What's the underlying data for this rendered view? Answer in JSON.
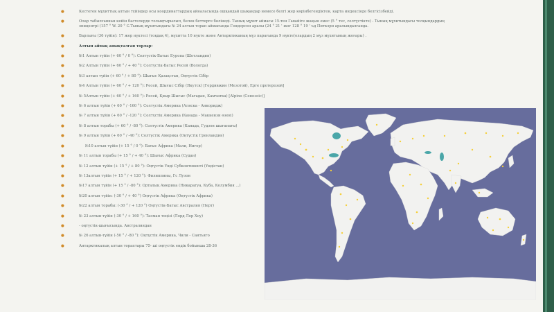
{
  "bullets": [
    {
      "text": "Кестеген мұхиттық алтын түйіндер осы координаттардың айналасында ошқандай шықандар немесе белгі жер көрінбегендіктен, карта индексінде белгісізбейді."
    },
    {
      "text": "Олар табылғаннан кейін бастелерде толықтырылып, белек беттерге бөлінеді. Тынық мұхит аймағы 15-тен Гавайіге жақын емес (5 ° тес, солтүстікте) - Тынық мұхитындағы толқындардың эпицентрі (157 ° W. 20 ° С.Тынық мұхитындағы № 24 алтын торап аймағында Гендерсон аралы (24 ° 21 ' жоғ 128 ° 19 ' ъд Питкэрн аралындалғанда."
    },
    {
      "text": "Барлығы (36 түйін): 17 жер нүктесі (тоқдақ 4), мұхитта 10 нүкте және Антарктиканың мұз парағында 9 нүкте(олардың 2 мұз мұхитының жоғары) ."
    },
    {
      "text": "Алтын аймақ анықталған торлар:",
      "head": true
    },
    {
      "text": "№1 Алтын түйін (+ 60 ° / 0 °): Солтүстік-Батыс Еуропа (Шотландия)"
    },
    {
      "text": "№2 Алтын түйін (+ 60 ° / + 40 °): Солтүстік-Батыс Ресей (Вологда)"
    },
    {
      "text": "№3 алтын түйін (+ 60 ° / + 80 °): Шығыс Қазақстан, Оңтүстік Сібір"
    },
    {
      "text": "№4 Алтын түйін (+ 60 ° / + 120 °): Ресей, Шығыс Сібір (Якутск) [Гердивжин (Мезотой), Ерге протерозой]"
    },
    {
      "text": "№ 5Алтын түйін (+ 60 ° / + 160 °): Ресей, Қиыр Шығыс (Магадан, Камчатка) [Alpino (Сенозоic)]"
    },
    {
      "text": "№ 6 алтын түйін (+ 60 ° / -160 °): Солтүстік Америка (Аляска - Анкоридж)"
    },
    {
      "text": "№ 7 алтын түйін (+ 60 ° / -120 °): Солтүстік Америка (Канада - Маккензи өзені)"
    },
    {
      "text": "№ 8 алтын торабы (+ 60 ° / -80 °): Солтүстік Америка (Канада, Гудзон шығанағы)"
    },
    {
      "text": "№ 9 алтын түйін (+ 60 ° / -40 °): Солтүстік Америка (Оңтүстік Гренландия)"
    },
    {
      "text": "№10 алтын түйін (+ 15 ° / 0 °): Батыс Африка (Мали, Нигер)",
      "indent": true
    },
    {
      "text": "№ 11 алтын торабы (+ 15 ° / + 40 °): Шығыс Африка (Судан)"
    },
    {
      "text": "№ 12 алтын түйін (+ 15 ° / + 80 °): Оңтүстік Үнді Субконтиненті (Үндістан)"
    },
    {
      "text": "№ 13алтын түйін (+ 15 ° / + 120 °): Филиппины, Гс Лузон"
    },
    {
      "text": "№17 алтын түйін (+ 15 ° / -80 °): Орталық Америка (Никарагуа, Куба, Колумбия ...)"
    },
    {
      "text": "№20 алтын түйін: (-30 ° / + 40 °) Оңтүстік Африка (Оңтүстік Африка)"
    },
    {
      "text": "№22 алтын торабы: (-30 ° / + 120 °) Оңтүстік-Батыс Австралия (Перт)"
    },
    {
      "text": "№ 23 алтын-түйін (-30 ° / + 160 °): Тасман теңізі (Лорд Лор Хоу)"
    },
    {
      "text": "- оңтүстік-шығысында. Австралиядан"
    },
    {
      "text": "№ 26 алтын-түйін (-50 ° / -80 °): Оңтүстік Америка, Чили - Сантьяго"
    },
    {
      "text": "Антарктикалық алтын тораптары 75- ші оңтүстік ендік бойынша 28-36"
    }
  ],
  "colors": {
    "bullet": "#d08b2a",
    "ocean": "#676d9d",
    "land": "#f0f0f0",
    "gold": "#f5cf3a",
    "water_feature": "#4aa6a8",
    "side_bar": "#2e5f49"
  },
  "map": {
    "name": "world-map"
  }
}
